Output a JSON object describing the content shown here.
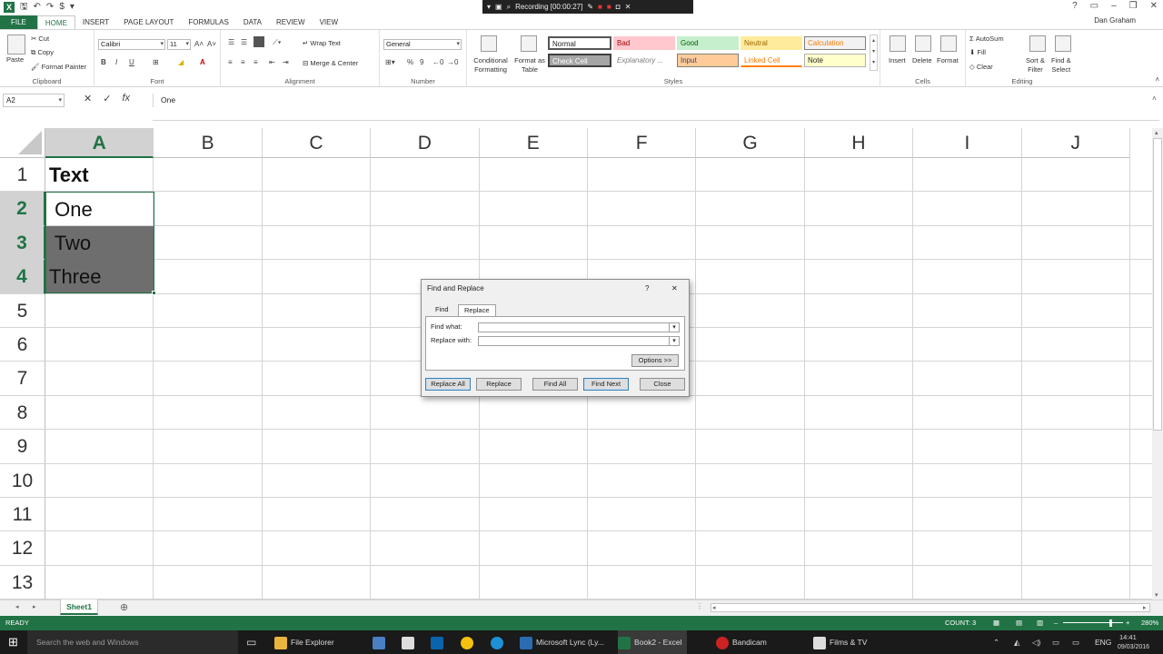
{
  "qat": {
    "save_icon": "save-icon",
    "undo_icon": "undo-icon",
    "redo_icon": "redo-icon"
  },
  "recorder": {
    "label": "Recording [00:00:27]"
  },
  "window": {
    "help": "?",
    "minimize": "–",
    "restore": "❐",
    "close": "✕",
    "user": "Dan Graham"
  },
  "tabs": [
    "FILE",
    "HOME",
    "INSERT",
    "PAGE LAYOUT",
    "FORMULAS",
    "DATA",
    "REVIEW",
    "VIEW"
  ],
  "ribbon": {
    "clipboard": {
      "paste": "Paste",
      "cut": "Cut",
      "copy": "Copy",
      "format_painter": "Format Painter",
      "label": "Clipboard"
    },
    "font": {
      "name": "Calibri",
      "size": "11",
      "bold": "B",
      "italic": "I",
      "underline": "U",
      "label": "Font"
    },
    "alignment": {
      "wrap": "Wrap Text",
      "merge": "Merge & Center",
      "label": "Alignment"
    },
    "number": {
      "format": "General",
      "percent": "%",
      "comma": "9",
      "label": "Number"
    },
    "styles": {
      "conditional_1": "Conditional",
      "conditional_2": "Formatting",
      "table_1": "Format as",
      "table_2": "Table",
      "normal": "Normal",
      "bad": "Bad",
      "good": "Good",
      "neutral": "Neutral",
      "calculation": "Calculation",
      "check": "Check Cell",
      "explanatory": "Explanatory ...",
      "input": "Input",
      "linked": "Linked Cell",
      "note": "Note",
      "label": "Styles"
    },
    "cells": {
      "insert": "Insert",
      "delete": "Delete",
      "format": "Format",
      "label": "Cells"
    },
    "editing": {
      "autosum": "AutoSum",
      "fill": "Fill",
      "clear": "Clear",
      "sort_1": "Sort &",
      "sort_2": "Filter",
      "find_1": "Find &",
      "find_2": "Select",
      "label": "Editing"
    }
  },
  "formula_bar": {
    "name_box": "A2",
    "cancel": "✕",
    "enter": "✓",
    "fx": "fx",
    "content": "One"
  },
  "grid": {
    "columns": [
      "A",
      "B",
      "C",
      "D",
      "E",
      "F",
      "G",
      "H",
      "I",
      "J"
    ],
    "rows": [
      "1",
      "2",
      "3",
      "4",
      "5",
      "6",
      "7",
      "8",
      "9",
      "10",
      "11",
      "12",
      "13"
    ],
    "cells": {
      "A1": "Text",
      "A2": " One",
      "A3": " Two",
      "A4": "Three"
    }
  },
  "sheets": {
    "active": "Sheet1",
    "add": "⊕"
  },
  "status": {
    "ready": "READY",
    "count": "COUNT: 3",
    "zoom": "280%"
  },
  "dialog": {
    "title": "Find and Replace",
    "help": "?",
    "close_x": "✕",
    "tab_find": "Find",
    "tab_replace": "Replace",
    "find_what": "Find what:",
    "replace_with": "Replace with:",
    "find_value": "",
    "replace_value": "",
    "options": "Options >>",
    "replace_all": "Replace All",
    "replace": "Replace",
    "find_all": "Find All",
    "find_next": "Find Next",
    "close": "Close"
  },
  "taskbar": {
    "search": "Search the web and Windows",
    "file_explorer": "File Explorer",
    "lync": "Microsoft Lync (Ly...",
    "excel": "Book2 - Excel",
    "bandicam": "Bandicam",
    "films": "Films & TV",
    "lang": "ENG",
    "time": "14:41",
    "date": "09/03/2016"
  },
  "colors": {
    "excel_green": "#217346",
    "selection_shade": "#6e6e6e"
  }
}
